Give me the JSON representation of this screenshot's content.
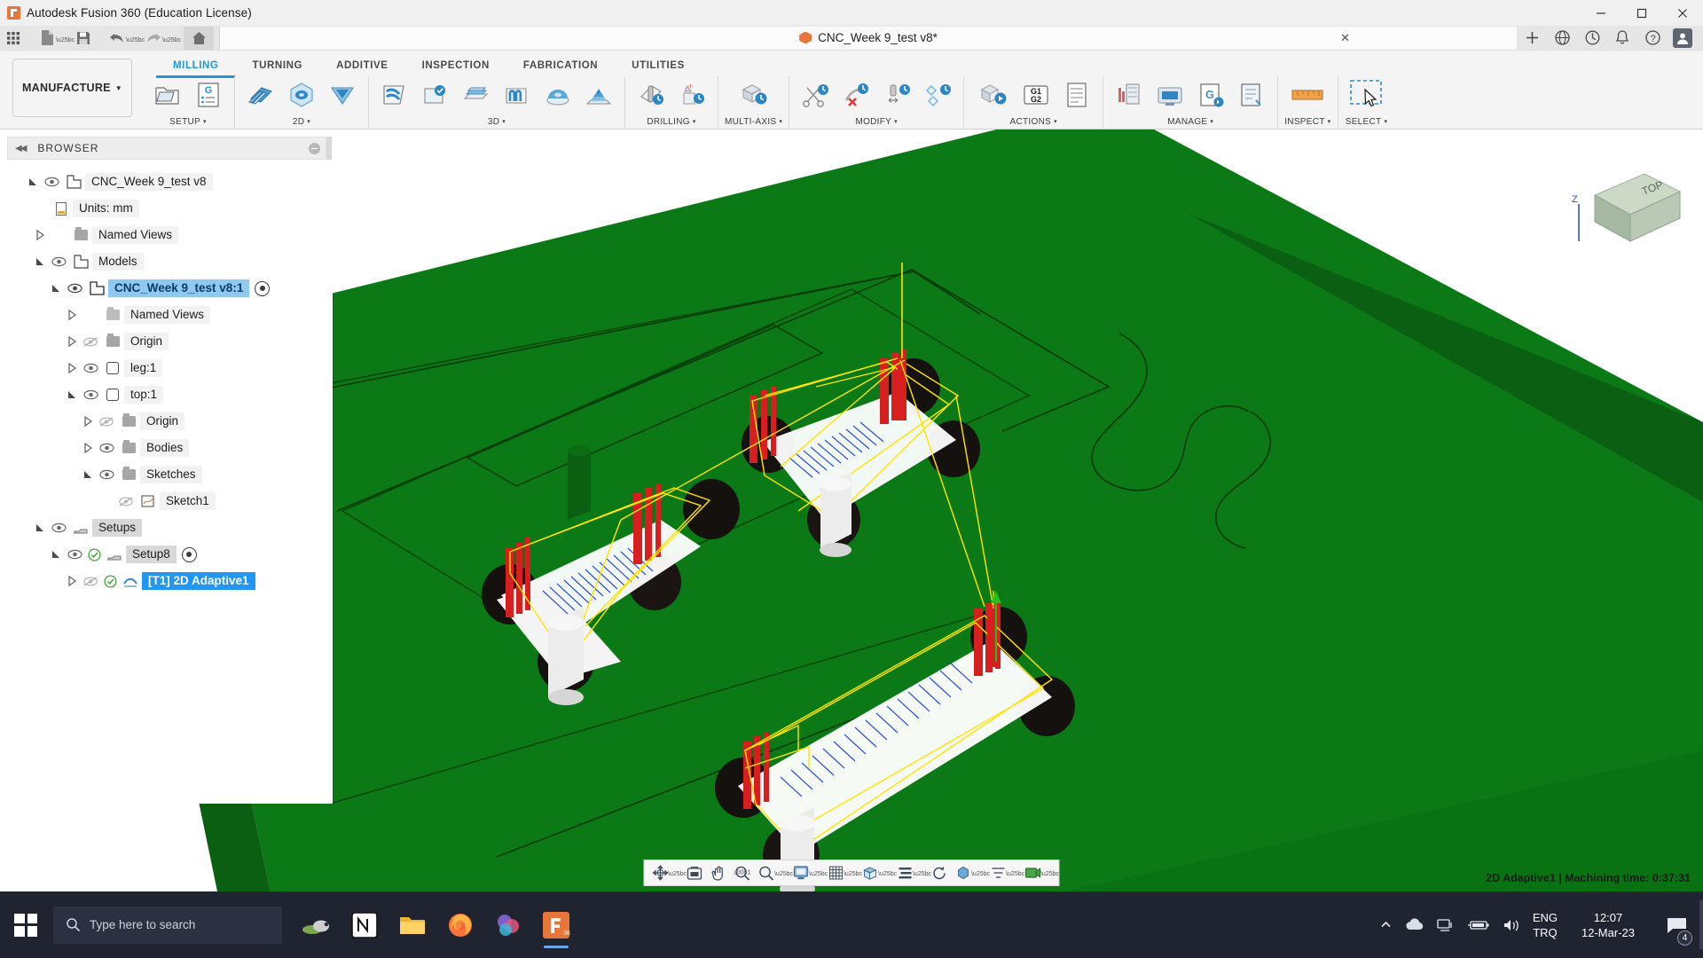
{
  "titlebar": {
    "app_title": "Autodesk Fusion 360 (Education License)",
    "minimize": "–",
    "maximize": "☐",
    "close": "✕"
  },
  "quick_access": {
    "items": [
      {
        "name": "grid-apps-icon",
        "label": ""
      },
      {
        "name": "new-document-icon",
        "label": ""
      },
      {
        "name": "save-icon",
        "label": ""
      },
      {
        "name": "undo-icon",
        "label": ""
      },
      {
        "name": "redo-icon",
        "label": ""
      },
      {
        "name": "home-icon",
        "label": ""
      }
    ],
    "document_tab": "CNC_Week 9_test v8*",
    "close_tab": "✕",
    "add_tab": "+",
    "right_icons": [
      "help-globe-icon",
      "job-status-icon",
      "notifications-bell-icon",
      "help-icon"
    ],
    "avatar_initials": "●"
  },
  "ribbon": {
    "workspace": "MANUFACTURE",
    "workspace_caret": "▼",
    "tabs": [
      {
        "label": "MILLING",
        "active": true
      },
      {
        "label": "TURNING",
        "active": false
      },
      {
        "label": "ADDITIVE",
        "active": false
      },
      {
        "label": "INSPECTION",
        "active": false
      },
      {
        "label": "FABRICATION",
        "active": false
      },
      {
        "label": "UTILITIES",
        "active": false
      }
    ],
    "panels": [
      {
        "label": "SETUP",
        "caret": "▾",
        "buttons": [
          "setup-icon",
          "g-code-list-icon"
        ]
      },
      {
        "label": "2D",
        "caret": "▾",
        "buttons": [
          "face-icon",
          "adaptive-2d-icon",
          "contour-2d-icon"
        ]
      },
      {
        "label": "3D",
        "caret": "▾",
        "buttons": [
          "adaptive-3d-icon",
          "pocket-clearing-icon",
          "horizontal-icon",
          "parallel-icon",
          "scallop-icon",
          "spiral-icon"
        ]
      },
      {
        "label": "DRILLING",
        "caret": "▾",
        "buttons": [
          "drill-icon",
          "bore-icon"
        ]
      },
      {
        "label": "MULTI-AXIS",
        "caret": "▾",
        "buttons": [
          "swarf-icon"
        ]
      },
      {
        "label": "MODIFY",
        "caret": "▾",
        "buttons": [
          "cut-icon",
          "delete-toolpath-icon",
          "simplify-icon",
          "optimize-icon"
        ]
      },
      {
        "label": "ACTIONS",
        "caret": "▾",
        "buttons": [
          "simulate-icon",
          "g1g2-post-process-icon",
          "setup-sheet-icon"
        ]
      },
      {
        "label": "MANAGE",
        "caret": "▾",
        "buttons": [
          "tool-library-icon",
          "machine-library-icon",
          "generate-icon",
          "post-library-icon"
        ]
      },
      {
        "label": "INSPECT",
        "caret": "▾",
        "buttons": [
          "measure-icon"
        ]
      },
      {
        "label": "SELECT",
        "caret": "▾",
        "buttons": [
          "select-window-icon"
        ]
      }
    ]
  },
  "browser": {
    "title": "BROWSER",
    "collapse": "◀◀",
    "tree": [
      {
        "label": "CNC_Week 9_test v8",
        "indent": 0,
        "expander": "down",
        "eye": "visible",
        "icon": "component-icon",
        "state": "normal"
      },
      {
        "label": "Units: mm",
        "indent": 1,
        "expander": "none",
        "eye": "none",
        "icon": "document-icon",
        "state": "normal"
      },
      {
        "label": "Named Views",
        "indent": 1,
        "expander": "right",
        "eye": "none",
        "icon": "folder-icon",
        "state": "normal"
      },
      {
        "label": "Models",
        "indent": 1,
        "expander": "down",
        "eye": "visible",
        "icon": "component-icon",
        "state": "normal"
      },
      {
        "label": "CNC_Week 9_test v8:1",
        "indent": 2,
        "expander": "down",
        "eye": "visible",
        "icon": "component-icon",
        "state": "selected",
        "target": true
      },
      {
        "label": "Named Views",
        "indent": 3,
        "expander": "right",
        "eye": "none",
        "icon": "folder-icon",
        "state": "normal"
      },
      {
        "label": "Origin",
        "indent": 3,
        "expander": "right",
        "eye": "hidden",
        "icon": "folder-icon",
        "state": "normal"
      },
      {
        "label": "leg:1",
        "indent": 3,
        "expander": "right",
        "eye": "visible",
        "icon": "body-icon",
        "state": "normal"
      },
      {
        "label": "top:1",
        "indent": 3,
        "expander": "down",
        "eye": "visible",
        "icon": "body-icon",
        "state": "normal"
      },
      {
        "label": "Origin",
        "indent": 4,
        "expander": "right",
        "eye": "hidden",
        "icon": "folder-icon",
        "state": "normal"
      },
      {
        "label": "Bodies",
        "indent": 4,
        "expander": "right",
        "eye": "visible",
        "icon": "folder-icon",
        "state": "normal"
      },
      {
        "label": "Sketches",
        "indent": 4,
        "expander": "down",
        "eye": "visible",
        "icon": "folder-icon",
        "state": "normal"
      },
      {
        "label": "Sketch1",
        "indent": 5,
        "expander": "none",
        "eye": "hidden",
        "icon": "sketch-icon",
        "state": "normal"
      },
      {
        "label": "Setups",
        "indent": 1,
        "expander": "down",
        "eye": "visible",
        "icon": "setups-icon",
        "state": "semi"
      },
      {
        "label": "Setup8",
        "indent": 2,
        "expander": "down",
        "eye": "visible",
        "icon": "setup-icon",
        "state": "semi",
        "check": true,
        "target": true
      },
      {
        "label": "[T1] 2D Adaptive1",
        "indent": 3,
        "expander": "right",
        "eye": "hidden",
        "icon": "toolpath-icon",
        "state": "highlight",
        "check": true
      }
    ]
  },
  "viewcube": {
    "face_label": "TOP",
    "axis_z": "Z"
  },
  "navbar": {
    "items": [
      {
        "name": "orbit-icon",
        "caret": true
      },
      {
        "name": "look-at-icon",
        "caret": false
      },
      {
        "name": "pan-hand-icon",
        "caret": false
      },
      {
        "name": "zoom-icon",
        "caret": false
      },
      {
        "name": "zoom-window-icon",
        "caret": true
      },
      {
        "name": "display-settings-icon",
        "caret": true
      },
      {
        "name": "grid-snaps-icon",
        "caret": true
      },
      {
        "name": "viewports-icon",
        "caret": true
      },
      {
        "name": "layout-grid-icon",
        "caret": true
      },
      {
        "name": "refresh-icon",
        "caret": false
      },
      {
        "name": "appearance-icon",
        "caret": true
      },
      {
        "name": "filter-icon",
        "caret": true
      },
      {
        "name": "effects-icon",
        "caret": true
      }
    ]
  },
  "status": {
    "text": "2D Adaptive1 | Machining time: 0:37:31"
  },
  "taskbar": {
    "search_placeholder": "Type here to search",
    "apps": [
      {
        "name": "notion-app-icon"
      },
      {
        "name": "file-explorer-icon"
      },
      {
        "name": "firefox-icon"
      },
      {
        "name": "paint-3d-icon"
      },
      {
        "name": "fusion-360-icon",
        "active": true
      }
    ],
    "tray": {
      "language": "ENG",
      "keyboard": "TRQ",
      "time": "12:07",
      "date": "12-Mar-23",
      "notification_count": "4"
    }
  }
}
